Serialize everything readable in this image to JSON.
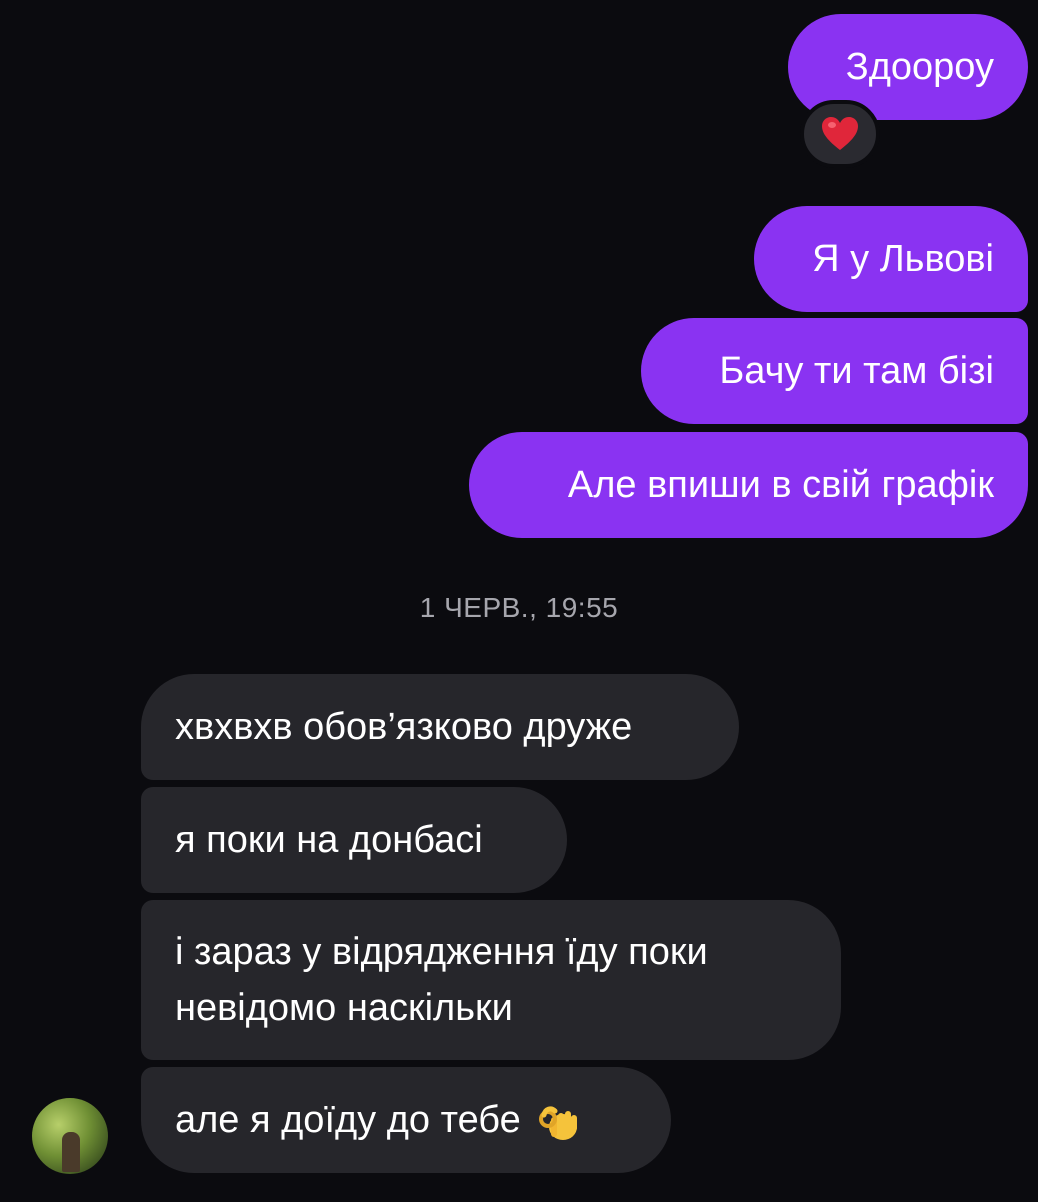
{
  "outgoing": [
    {
      "text": "Здоороу"
    },
    {
      "text": "Я у Львові"
    },
    {
      "text": "Бачу ти там бізі"
    },
    {
      "text": "Але впиши в свій графік"
    }
  ],
  "reaction": {
    "icon": "red-heart-icon",
    "emoji": "❤️",
    "color": "#e0263a"
  },
  "timestamp": "1 ЧЕРВ., 19:55",
  "incoming": [
    {
      "text": "хвхвхв обов’язково друже"
    },
    {
      "text": "я поки на донбасі"
    },
    {
      "text": "і зараз у відрядження їду поки невідомо наскільки"
    },
    {
      "text": "але я доїду до тебе",
      "emoji_icon": "ok-hand-icon"
    }
  ],
  "colors": {
    "background": "#0b0b0f",
    "outgoing_bubble": "#8a33f2",
    "incoming_bubble": "#26262b",
    "timestamp": "#a6a6ad"
  }
}
